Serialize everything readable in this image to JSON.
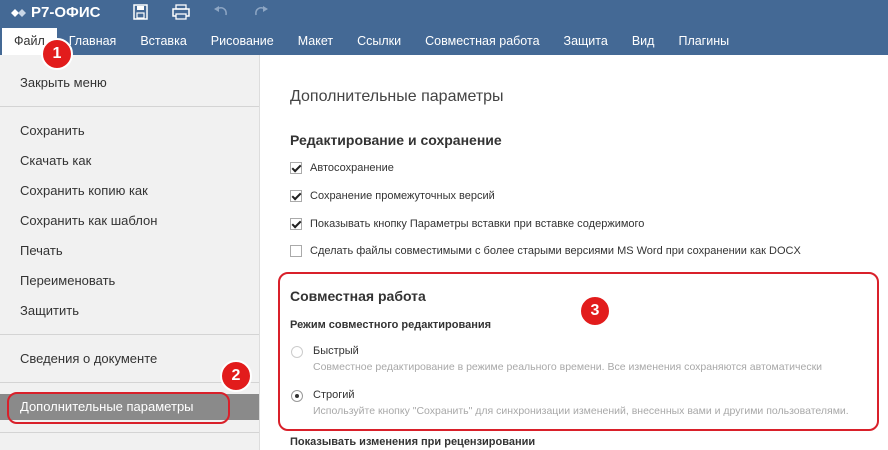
{
  "app": {
    "logo_text": "Р7-ОФИС"
  },
  "toolbar_icons": [
    "save-icon",
    "print-icon",
    "undo-icon",
    "redo-icon"
  ],
  "menu": [
    {
      "label": "Файл",
      "active": true
    },
    {
      "label": "Главная"
    },
    {
      "label": "Вставка"
    },
    {
      "label": "Рисование"
    },
    {
      "label": "Макет"
    },
    {
      "label": "Ссылки"
    },
    {
      "label": "Совместная работа"
    },
    {
      "label": "Защита"
    },
    {
      "label": "Вид"
    },
    {
      "label": "Плагины"
    }
  ],
  "file_menu": {
    "close": "Закрыть меню",
    "save": "Сохранить",
    "download_as": "Скачать как",
    "save_copy_as": "Сохранить копию как",
    "save_as_template": "Сохранить как шаблон",
    "print": "Печать",
    "rename": "Переименовать",
    "protect": "Защитить",
    "doc_info": "Сведения о документе",
    "advanced_settings": "Дополнительные параметры"
  },
  "settings": {
    "title": "Дополнительные параметры",
    "editing_section": "Редактирование и сохранение",
    "autosave": {
      "label": "Автосохранение",
      "checked": true
    },
    "save_versions": {
      "label": "Сохранение промежуточных версий",
      "checked": true
    },
    "paste_button": {
      "label": "Показывать кнопку Параметры вставки при вставке содержимого",
      "checked": true
    },
    "compat": {
      "label": "Сделать файлы совместимыми с более старыми версиями MS Word при сохранении как DOCX",
      "checked": false
    },
    "collab_section": "Совместная работа",
    "coedit_mode": "Режим совместного редактирования",
    "fast": {
      "label": "Быстрый",
      "desc": "Совместное редактирование в режиме реального времени. Все изменения сохраняются автоматически",
      "checked": false
    },
    "strict": {
      "label": "Строгий",
      "desc": "Используйте кнопку \"Сохранить\" для синхронизации изменений, внесенных вами и другими пользователями.",
      "checked": true
    },
    "review_changes": "Показывать изменения при рецензировании"
  },
  "callouts": [
    "1",
    "2",
    "3"
  ],
  "colors": {
    "topbar": "#446995",
    "highlight": "#d9202a",
    "callout": "#e21c1c",
    "active_item": "#8a8a8a"
  }
}
